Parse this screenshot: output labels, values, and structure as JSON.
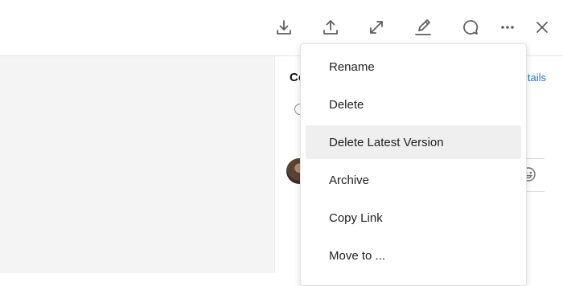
{
  "toolbar": {
    "buttons": [
      {
        "icon": "download-icon"
      },
      {
        "icon": "upload-icon"
      },
      {
        "icon": "expand-icon"
      },
      {
        "icon": "edit-icon"
      },
      {
        "icon": "comment-icon"
      },
      {
        "icon": "more-icon"
      },
      {
        "icon": "close-icon"
      }
    ]
  },
  "sidebar": {
    "title_partial": "Co",
    "details_partial": "tails"
  },
  "menu": {
    "items": [
      {
        "label": "Rename"
      },
      {
        "label": "Delete"
      },
      {
        "label": "Delete Latest Version",
        "highlighted": true
      },
      {
        "label": "Archive"
      },
      {
        "label": "Copy Link"
      },
      {
        "label": "Move to ..."
      }
    ]
  },
  "colors": {
    "link": "#1b73d1",
    "hover_bg": "#efefef",
    "icon": "#5f5f5f"
  }
}
